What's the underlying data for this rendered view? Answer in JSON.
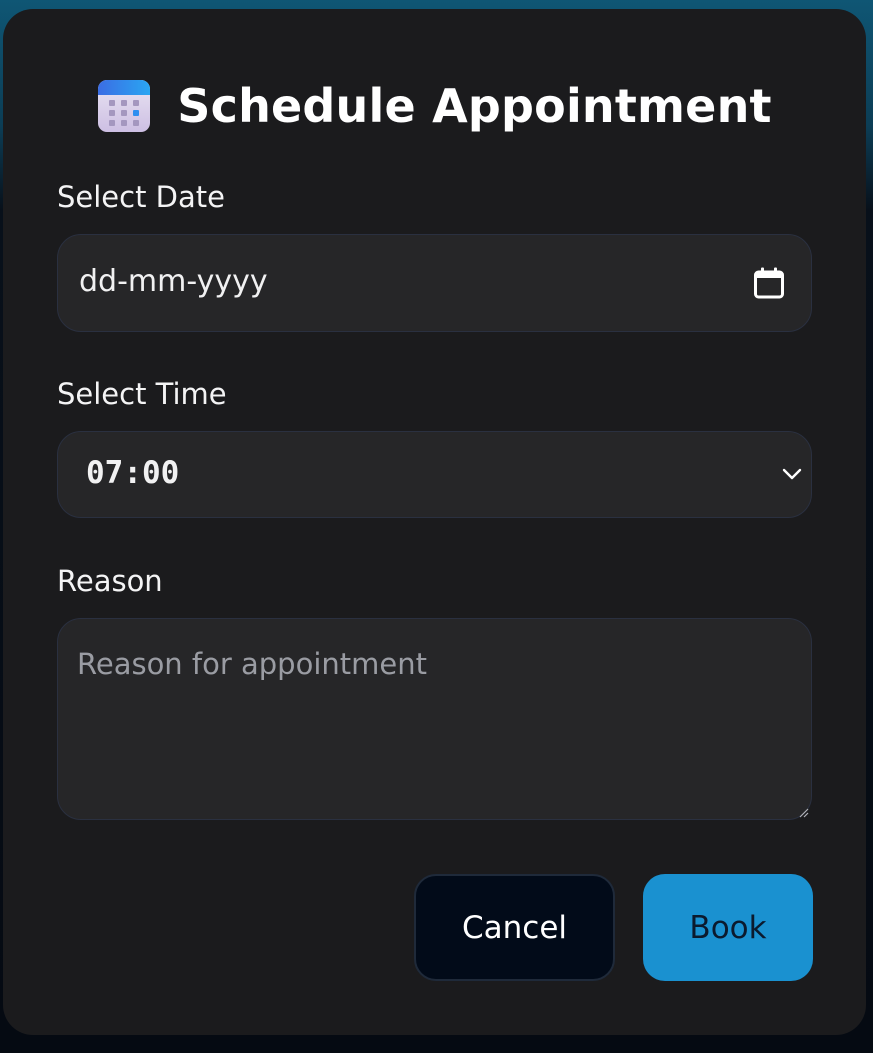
{
  "dialog": {
    "title": "Schedule Appointment",
    "icon": "calendar-emoji"
  },
  "date_field": {
    "label": "Select Date",
    "placeholder": "dd-mm-yyyy",
    "icon": "calendar-icon"
  },
  "time_field": {
    "label": "Select Time",
    "selected_value": "07:00",
    "icon": "chevron-down-icon"
  },
  "reason_field": {
    "label": "Reason",
    "placeholder": "Reason for appointment",
    "value": ""
  },
  "actions": {
    "cancel_label": "Cancel",
    "book_label": "Book"
  },
  "colors": {
    "dialog_background": "#1b1b1d",
    "input_background": "#262628",
    "book_button": "#1a91d0",
    "cancel_button": "#020b19",
    "placeholder_text": "#9a9ca3"
  }
}
